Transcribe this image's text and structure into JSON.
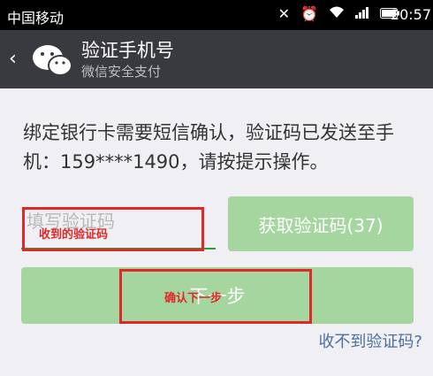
{
  "status_bar": {
    "carrier": "中国移动",
    "time": "20:57",
    "icons": [
      "mute-icon",
      "alarm-icon",
      "wifi-icon",
      "signal-icon",
      "battery-icon"
    ]
  },
  "header": {
    "title": "验证手机号",
    "subtitle": "微信安全支付"
  },
  "main": {
    "description": "绑定银行卡需要短信确认，验证码已发送至手机：159****1490，请按提示操作。",
    "code_input": {
      "placeholder": "填写验证码",
      "value": ""
    },
    "get_code_button": "获取验证码(37)",
    "next_button": "下一步",
    "no_code_link": "收不到验证码?"
  },
  "annotations": {
    "input_note": "收到的验证码",
    "button_note": "确认下一步"
  },
  "colors": {
    "titlebar": "#393a3f",
    "button_disabled_green": "#a6d6a0",
    "input_underline": "#2aa138",
    "link": "#4d6f9d",
    "annotation_red": "#e02828"
  }
}
